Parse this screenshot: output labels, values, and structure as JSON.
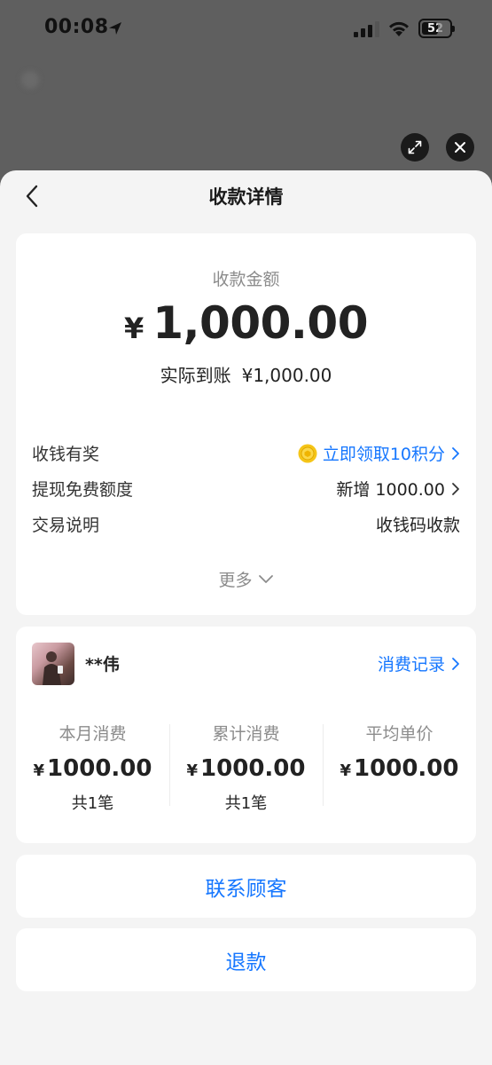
{
  "status_bar": {
    "time": "00:08",
    "battery": "52"
  },
  "nav": {
    "title": "收款详情"
  },
  "amount_card": {
    "label": "收款金额",
    "currency_symbol": "¥",
    "amount": "1,000.00",
    "actual_label": "实际到账",
    "actual_value": "¥1,000.00",
    "rows": [
      {
        "label": "收钱有奖",
        "value": "立即领取10积分"
      },
      {
        "label": "提现免费额度",
        "value": "新增 1000.00"
      },
      {
        "label": "交易说明",
        "value": "收钱码收款"
      }
    ],
    "more_label": "更多"
  },
  "customer_card": {
    "name": "**伟",
    "link_label": "消费记录",
    "stats": [
      {
        "label": "本月消费",
        "symbol": "¥",
        "value": "1000.00",
        "sub": "共1笔"
      },
      {
        "label": "累计消费",
        "symbol": "¥",
        "value": "1000.00",
        "sub": "共1笔"
      },
      {
        "label": "平均单价",
        "symbol": "¥",
        "value": "1000.00",
        "sub": ""
      }
    ]
  },
  "actions": {
    "contact_label": "联系顾客",
    "refund_label": "退款"
  },
  "colors": {
    "accent": "#1677ff",
    "sheet_bg": "#f4f4f4",
    "card_bg": "#ffffff",
    "muted_text": "#8c8c8c"
  }
}
